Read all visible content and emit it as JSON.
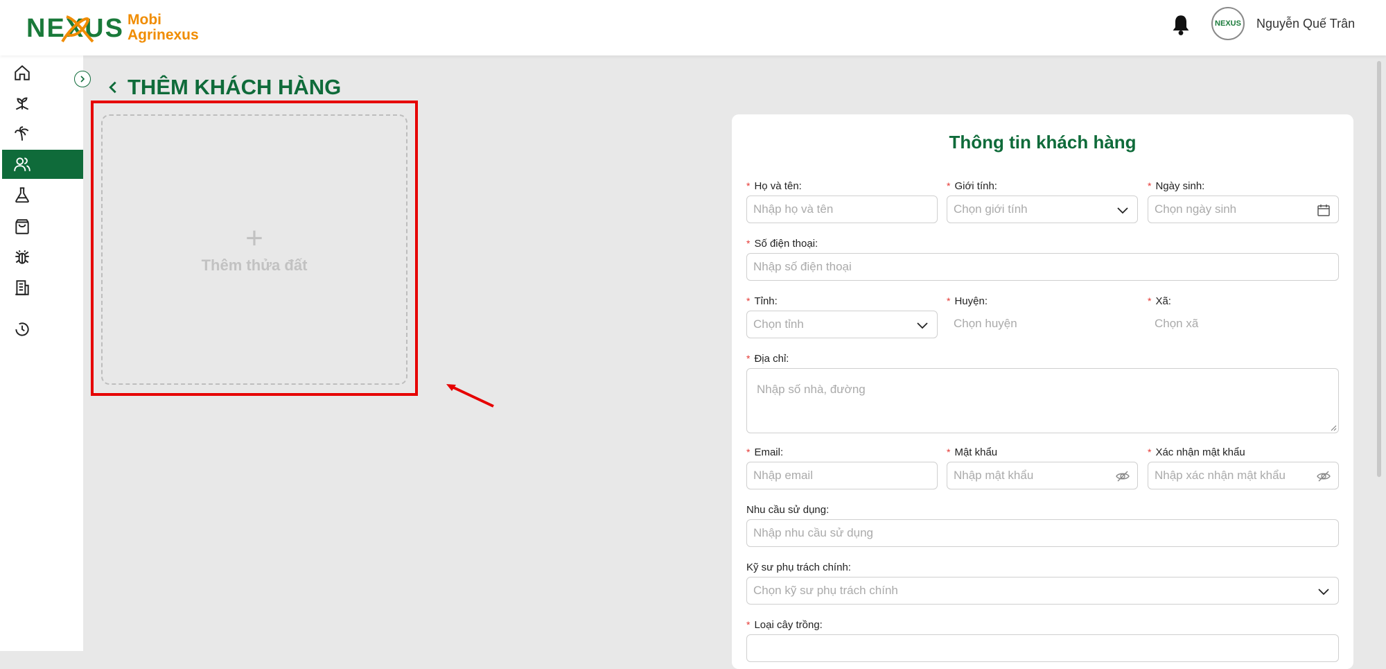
{
  "app": {
    "logo_word": "NEXUS",
    "logo_line1": "Mobi",
    "logo_line2": "Agrinexus",
    "user_name": "Nguyễn Quế Trân",
    "avatar_text": "NEXUS"
  },
  "sidebar": {
    "items": [
      {
        "name": "home-icon",
        "active": false
      },
      {
        "name": "plant-icon",
        "active": false
      },
      {
        "name": "palm-tree-icon",
        "active": false
      },
      {
        "name": "users-icon",
        "active": true
      },
      {
        "name": "flask-icon",
        "active": false
      },
      {
        "name": "shopping-bag-icon",
        "active": false
      },
      {
        "name": "bug-icon",
        "active": false
      },
      {
        "name": "building-icon",
        "active": false
      },
      {
        "name": "history-icon",
        "active": false
      }
    ]
  },
  "page": {
    "title": "THÊM KHÁCH HÀNG",
    "add_land_plus": "+",
    "add_land_label": "Thêm thửa đất"
  },
  "form": {
    "title": "Thông tin khách hàng",
    "required_mark": "*",
    "fields": {
      "full_name": {
        "label": "Họ và tên:",
        "placeholder": "Nhập họ và tên"
      },
      "gender": {
        "label": "Giới tính:",
        "placeholder": "Chọn giới tính"
      },
      "birthday": {
        "label": "Ngày sinh:",
        "placeholder": "Chọn ngày sinh"
      },
      "phone": {
        "label": "Số điện thoại:",
        "placeholder": "Nhập số điện thoại"
      },
      "province": {
        "label": "Tỉnh:",
        "placeholder": "Chọn tỉnh"
      },
      "district": {
        "label": "Huyện:",
        "placeholder": "Chọn huyện"
      },
      "ward": {
        "label": "Xã:",
        "placeholder": "Chọn xã"
      },
      "address": {
        "label": "Địa chỉ:",
        "placeholder": "Nhập số nhà, đường"
      },
      "email": {
        "label": "Email:",
        "placeholder": "Nhập email"
      },
      "password": {
        "label": "Mật khẩu",
        "placeholder": "Nhập mật khẩu"
      },
      "confirm_password": {
        "label": "Xác nhận mật khẩu",
        "placeholder": "Nhập xác nhận mật khẩu"
      },
      "usage_needs": {
        "label": "Nhu cầu sử dụng:",
        "placeholder": "Nhập nhu cầu sử dụng"
      },
      "engineer": {
        "label": "Kỹ sư phụ trách chính:",
        "placeholder": "Chọn kỹ sư phụ trách chính"
      },
      "crop_type": {
        "label": "Loại cây trồng:",
        "placeholder": ""
      }
    }
  },
  "colors": {
    "brand_green": "#0f6b3a",
    "brand_orange": "#f08c00",
    "highlight_red": "#e60000",
    "required_red": "#e53935"
  }
}
